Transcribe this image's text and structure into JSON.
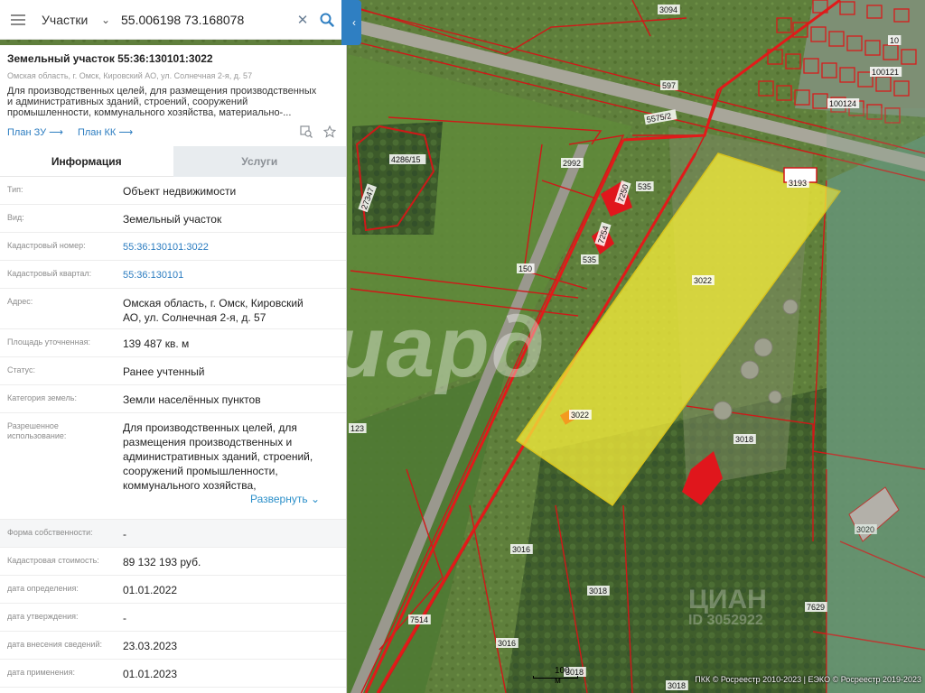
{
  "search": {
    "layer": "Участки",
    "value": "55.006198 73.168078"
  },
  "parcel": {
    "title": "Земельный участок 55:36:130101:3022",
    "address": "Омская область, г. Омск, Кировский АО, ул. Солнечная 2-я, д. 57",
    "description_lines": [
      "Для производственных целей, для размещения производственных",
      "и административных зданий, строений, сооружений",
      "промышленности, коммунального хозяйства, материально-..."
    ],
    "plan_zu": "План ЗУ",
    "plan_kk": "План КК"
  },
  "tabs": {
    "info": "Информация",
    "services": "Услуги"
  },
  "rows": [
    {
      "key": "Тип:",
      "value": "Объект недвижимости"
    },
    {
      "key": "Вид:",
      "value": "Земельный участок"
    },
    {
      "key": "Кадастровый номер:",
      "value": "55:36:130101:3022"
    },
    {
      "key": "Кадастровый квартал:",
      "value": "55:36:130101"
    },
    {
      "key": "Адрес:",
      "value_lines": [
        "Омская область, г. Омск, Кировский",
        "АО, ул. Солнечная 2-я, д. 57"
      ]
    },
    {
      "key": "Площадь уточненная:",
      "value": "139 487 кв. м"
    },
    {
      "key": "Статус:",
      "value": "Ранее учтенный"
    },
    {
      "key": "Категория земель:",
      "value": "Земли населённых пунктов"
    },
    {
      "key_lines": [
        "Разрешенное",
        "использование:"
      ],
      "value_lines": [
        "Для производственных целей, для",
        "размещения производственных и",
        "административных зданий, строений,",
        "сооружений промышленности,",
        "коммунального хозяйства,"
      ]
    },
    {
      "key": "Форма собственности:",
      "value": "-"
    },
    {
      "key": "Кадастровая стоимость:",
      "value": "89 132 193 руб."
    },
    {
      "key": "дата определения:",
      "value": "01.01.2022"
    },
    {
      "key": "дата утверждения:",
      "value": "-"
    },
    {
      "key": "дата внесения сведений:",
      "value": "23.03.2023"
    },
    {
      "key": "дата применения:",
      "value": "01.01.2023"
    }
  ],
  "expand_label": "Развернуть",
  "map": {
    "watermark": "Миард",
    "watermark2": "ЦИАН",
    "watermark2_sub": "ID 3052922",
    "scale_label": "100 м",
    "copyright": "ПКК © Росреестр 2010-2023 | ЕЭКО © Росреестр 2019-2023",
    "labels": [
      "3094",
      "597",
      "5575/2",
      "3193",
      "2992",
      "4286/15",
      "27347",
      "535",
      "535",
      "7250",
      "7254",
      "150",
      "3022",
      "3022",
      "123",
      "3018",
      "3016",
      "3016",
      "3018",
      "7514",
      "3018",
      "3018",
      "3020",
      "7629",
      "100121",
      "100124",
      "10"
    ]
  },
  "colors": {
    "accent": "#2f7fc2",
    "parcel_fill": "#f2ea3a",
    "boundary": "#d01818",
    "building": "#e0161c"
  }
}
